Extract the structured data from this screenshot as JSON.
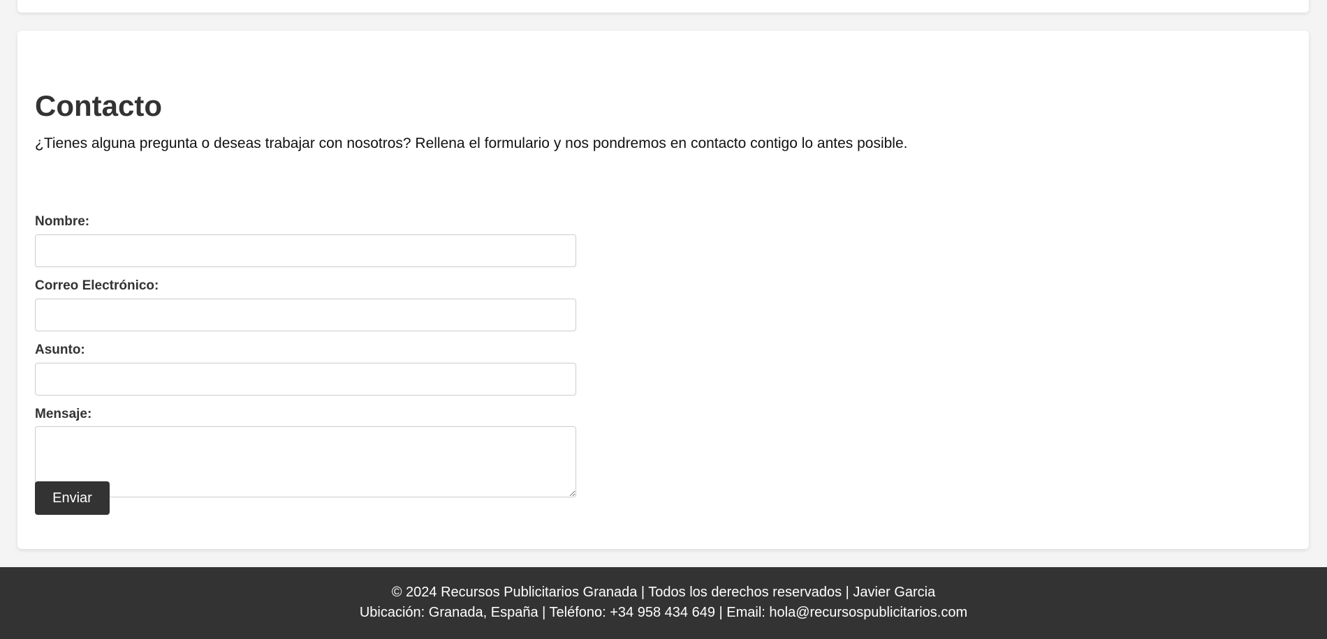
{
  "contact": {
    "title": "Contacto",
    "intro": "¿Tienes alguna pregunta o deseas trabajar con nosotros? Rellena el formulario y nos pondremos en contacto contigo lo antes posible.",
    "fields": [
      {
        "label": "Nombre:",
        "value": ""
      },
      {
        "label": "Correo Electrónico:",
        "value": ""
      },
      {
        "label": "Asunto:",
        "value": ""
      },
      {
        "label": "Mensaje:",
        "value": ""
      }
    ],
    "submit_label": "Enviar"
  },
  "footer": {
    "line1": "© 2024 Recursos Publicitarios Granada | Todos los derechos reservados | Javier Garcia",
    "line2": "Ubicación: Granada, España | Teléfono: +34 958 434 649 | Email: hola@recursospublicitarios.com"
  },
  "colors": {
    "page_background": "#f4f4f4",
    "card_background": "#ffffff",
    "footer_background": "#333333",
    "button_background": "#333333",
    "text_dark": "#333333"
  }
}
